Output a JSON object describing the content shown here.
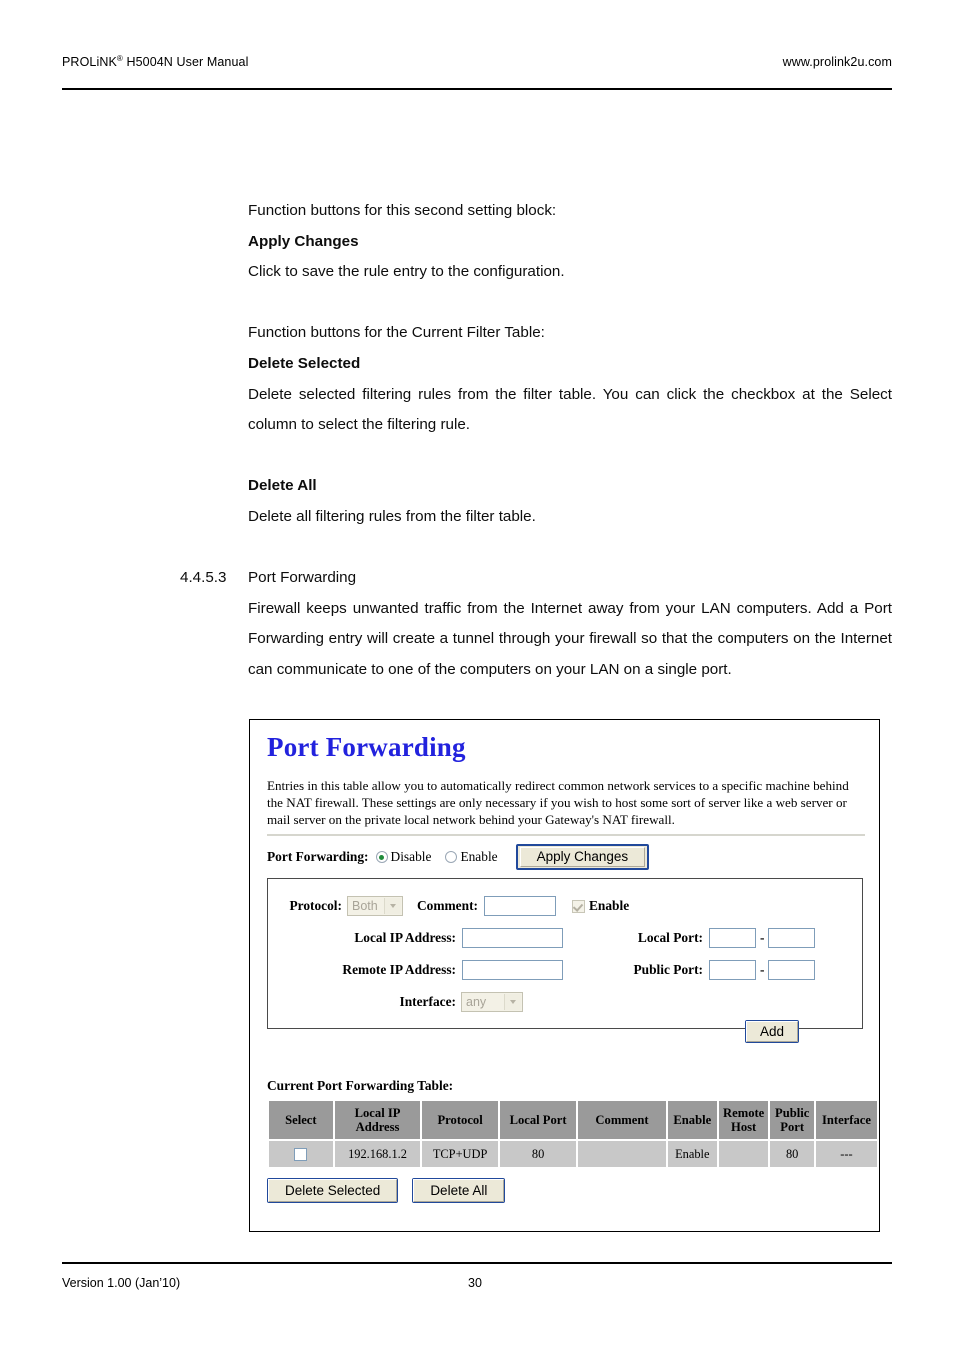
{
  "header": {
    "manual_title_main": "PROLiNK",
    "manual_title_reg": "®",
    "manual_title_rest": " H5004N User Manual",
    "site_url": "www.prolink2u.com"
  },
  "body": {
    "line_1": "Function buttons for this second setting block:",
    "heading_apply": "Apply Changes",
    "line_2": "Click to save the rule entry to the configuration.",
    "line_3": "Function buttons for the Current Filter Table:",
    "heading_delete_selected": "Delete Selected",
    "line_4": "Delete selected filtering rules from the filter table. You can click the checkbox at the Select column to select the filtering rule.",
    "heading_delete_all": "Delete All",
    "line_5": "Delete all filtering rules from the filter table.",
    "section_number": "4.4.5.3",
    "section_title": "Port Forwarding",
    "line_6": "Firewall keeps unwanted traffic from the Internet away from your LAN computers. Add a Port Forwarding entry will create a tunnel through your firewall so that the computers on the Internet can communicate to one of the computers on your LAN on a single port."
  },
  "screenshot": {
    "title": "Port Forwarding",
    "title_color": "#2222dd",
    "description": "Entries in this table allow you to automatically redirect common network services to a specific machine behind the NAT firewall. These settings are only necessary if you wish to host some sort of server like a web server or mail server on the private local network behind your Gateway's NAT firewall.",
    "port_forwarding_label": "Port Forwarding:",
    "radio_disable_label": "Disable",
    "radio_enable_label": "Enable",
    "radio_selected": "Disable",
    "apply_changes_label": "Apply Changes",
    "form": {
      "protocol_label": "Protocol:",
      "protocol_value": "Both",
      "comment_label": "Comment:",
      "comment_value": "",
      "enable_checkbox_label": "Enable",
      "enable_checkbox_checked": true,
      "local_ip_label": "Local IP Address:",
      "local_ip_value": "",
      "local_port_label": "Local Port:",
      "local_port_from": "",
      "local_port_to": "",
      "remote_ip_label": "Remote IP Address:",
      "remote_ip_value": "",
      "public_port_label": "Public Port:",
      "public_port_from": "",
      "public_port_to": "",
      "interface_label": "Interface:",
      "interface_value": "any",
      "port_range_dash": "-",
      "add_label": "Add"
    },
    "table": {
      "caption": "Current Port Forwarding Table:",
      "headers": [
        "Select",
        "Local IP Address",
        "Protocol",
        "Local Port",
        "Comment",
        "Enable",
        "Remote Host",
        "Public Port",
        "Interface"
      ],
      "rows": [
        {
          "selected": false,
          "local_ip": "192.168.1.2",
          "protocol": "TCP+UDP",
          "local_port": "80",
          "comment": "",
          "enable": "Enable",
          "remote_host": "",
          "public_port": "80",
          "interface": "---"
        }
      ]
    },
    "delete_selected_label": "Delete Selected",
    "delete_all_label": "Delete All"
  },
  "footer": {
    "version": "Version 1.00 (Jan’10)",
    "page_number": "30"
  }
}
